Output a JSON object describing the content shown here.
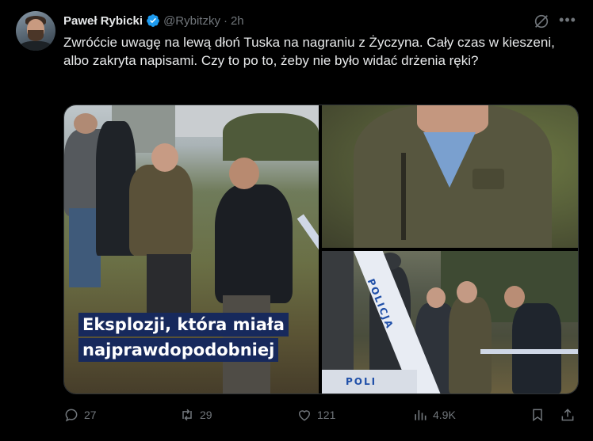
{
  "tweet": {
    "author_name": "Paweł Rybicki",
    "handle": "@Rybitzky",
    "separator": "·",
    "time": "2h",
    "text": "Zwróćcie uwagę na lewą dłoń Tuska na nagraniu z Życzyna. Cały czas w kieszeni, albo zakryta napisami. Czy to po to, żeby nie było widać drżenia ręki?"
  },
  "media": {
    "caption_line1": "Eksplozji, która miała",
    "caption_line2": "najprawdopodobniej",
    "tape_label_1": "POLICJA",
    "tape_label_2": "POLI"
  },
  "actions": {
    "replies": "27",
    "reposts": "29",
    "likes": "121",
    "views": "4.9K"
  },
  "colors": {
    "background": "#000000",
    "text": "#e7e9ea",
    "muted": "#71767b",
    "verified": "#1d9bf0",
    "caption_bg": "#17295c"
  },
  "icons": {
    "verified": "verified-badge-icon",
    "grok": "grok-icon",
    "more": "more-icon",
    "reply": "reply-icon",
    "repost": "repost-icon",
    "like": "like-icon",
    "views": "views-icon",
    "bookmark": "bookmark-icon",
    "share": "share-icon"
  }
}
